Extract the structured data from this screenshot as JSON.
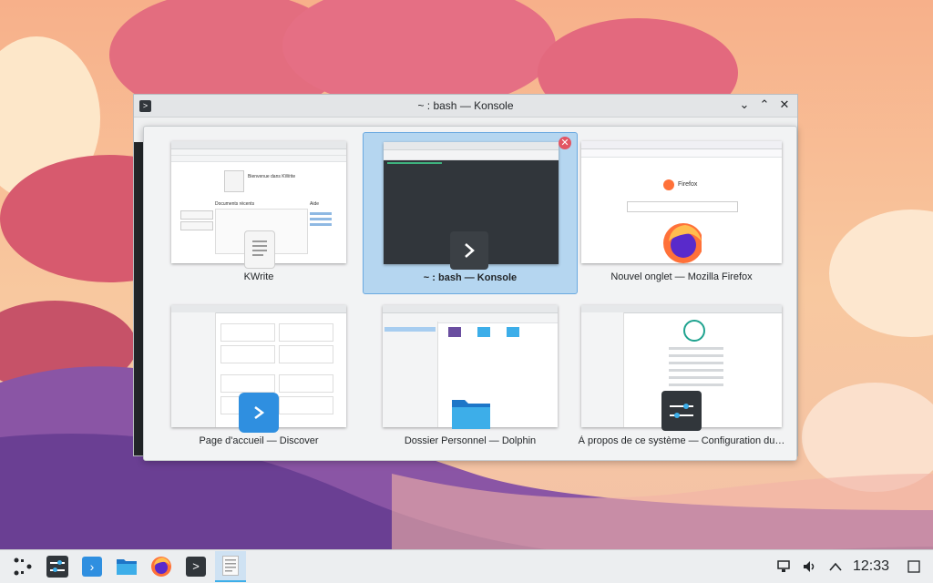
{
  "konsole_window": {
    "title": "~ : bash — Konsole",
    "app_icon": "terminal-icon"
  },
  "switcher": {
    "items": [
      {
        "label": "KWrite",
        "icon": "kwrite-icon",
        "preview": {
          "title": "KWrite",
          "welcome": "Bienvenue dans KWrite",
          "recent": "Documents récents",
          "help": "Aide"
        }
      },
      {
        "label": "~ : bash — Konsole",
        "icon": "konsole-icon",
        "selected": true,
        "preview": {
          "title": "bash — Konsole"
        }
      },
      {
        "label": "Nouvel onglet — Mozilla Firefox",
        "icon": "firefox-icon",
        "preview": {
          "brand": "Firefox"
        }
      },
      {
        "label": "Page d'accueil — Discover",
        "icon": "discover-icon",
        "preview": {
          "title": "Page d'accueil — Discover"
        }
      },
      {
        "label": "Dossier Personnel — Dolphin",
        "icon": "dolphin-icon",
        "preview": {
          "title": "Dossier Personnel — Dolphin"
        }
      },
      {
        "label": "À propos de ce système — Configuration du…",
        "icon": "system-settings-icon",
        "preview": {
          "title": "À propos de ce système"
        }
      }
    ]
  },
  "taskbar": {
    "launcher_icon": "plasma-launcher-icon",
    "apps": [
      {
        "name": "system-settings",
        "icon": "sliders-icon"
      },
      {
        "name": "discover",
        "icon": "discover-icon"
      },
      {
        "name": "dolphin",
        "icon": "folder-icon"
      },
      {
        "name": "firefox",
        "icon": "firefox-icon"
      },
      {
        "name": "konsole",
        "icon": "terminal-icon"
      },
      {
        "name": "kwrite",
        "icon": "text-editor-icon",
        "active": true
      }
    ],
    "tray": {
      "clock": "12:33",
      "icons": [
        "network-icon",
        "volume-icon",
        "chevron-up-icon",
        "show-desktop-icon"
      ]
    }
  },
  "colors": {
    "accent": "#3daee9",
    "selection": "#b5d6f0",
    "close_red": "#e25563",
    "firefox_orange": "#ff7139"
  }
}
